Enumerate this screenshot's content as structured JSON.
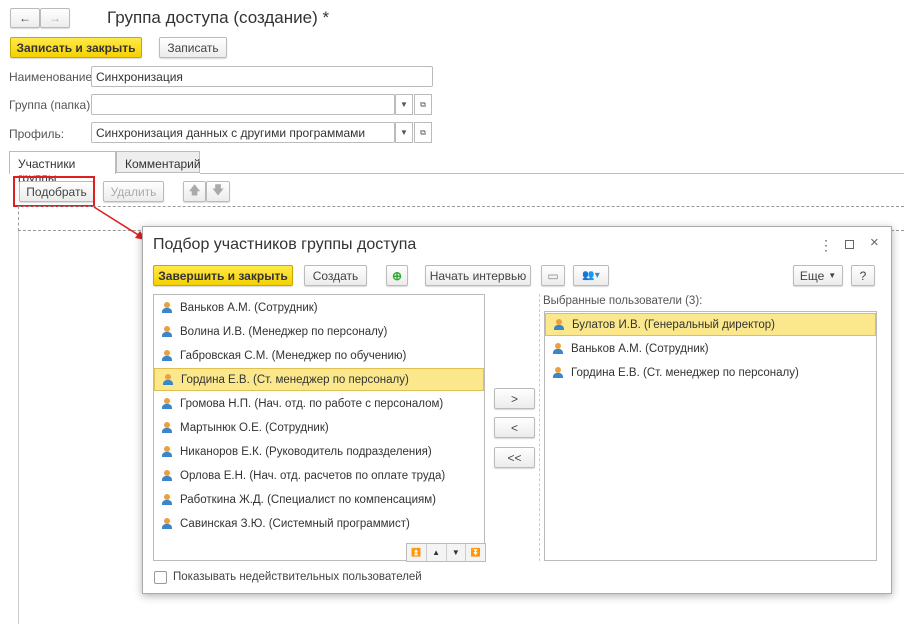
{
  "form": {
    "title": "Группа доступа (создание) *",
    "save_close": "Записать и закрыть",
    "save": "Записать",
    "name_label": "Наименование:",
    "name_value": "Синхронизация",
    "group_label": "Группа (папка):",
    "group_value": "",
    "profile_label": "Профиль:",
    "profile_value": "Синхронизация данных с другими программами",
    "tabs": [
      "Участники группы",
      "Комментарий"
    ],
    "pick": "Подобрать",
    "delete": "Удалить"
  },
  "dialog": {
    "title": "Подбор участников группы доступа",
    "finish_close": "Завершить и закрыть",
    "create": "Создать",
    "start_interview": "Начать интервью",
    "more": "Еще",
    "help": "?",
    "available": [
      "Ваньков А.М. (Сотрудник)",
      "Волина И.В. (Менеджер по персоналу)",
      "Габровская С.М. (Менеджер по обучению)",
      "Гордина Е.В. (Ст. менеджер по персоналу)",
      "Громова Н.П. (Нач. отд. по работе с персоналом)",
      "Мартынюк О.Е. (Сотрудник)",
      "Никаноров Е.К. (Руководитель подразделения)",
      "Орлова Е.Н. (Нач. отд. расчетов по оплате труда)",
      "Работкина Ж.Д. (Специалист по компенсациям)",
      "Савинская З.Ю. (Системный программист)"
    ],
    "selected_label": "Выбранные пользователи (3):",
    "selected": [
      "Булатов И.В. (Генеральный директор)",
      "Ваньков А.М. (Сотрудник)",
      "Гордина Е.В. (Ст. менеджер по персоналу)"
    ],
    "add": ">",
    "remove": "<",
    "remove_all": "<<",
    "show_invalid": "Показывать недействительных пользователей"
  },
  "colors": {
    "accent": "#f5d100",
    "highlight": "#fbe88c",
    "callout": "#e02020"
  }
}
